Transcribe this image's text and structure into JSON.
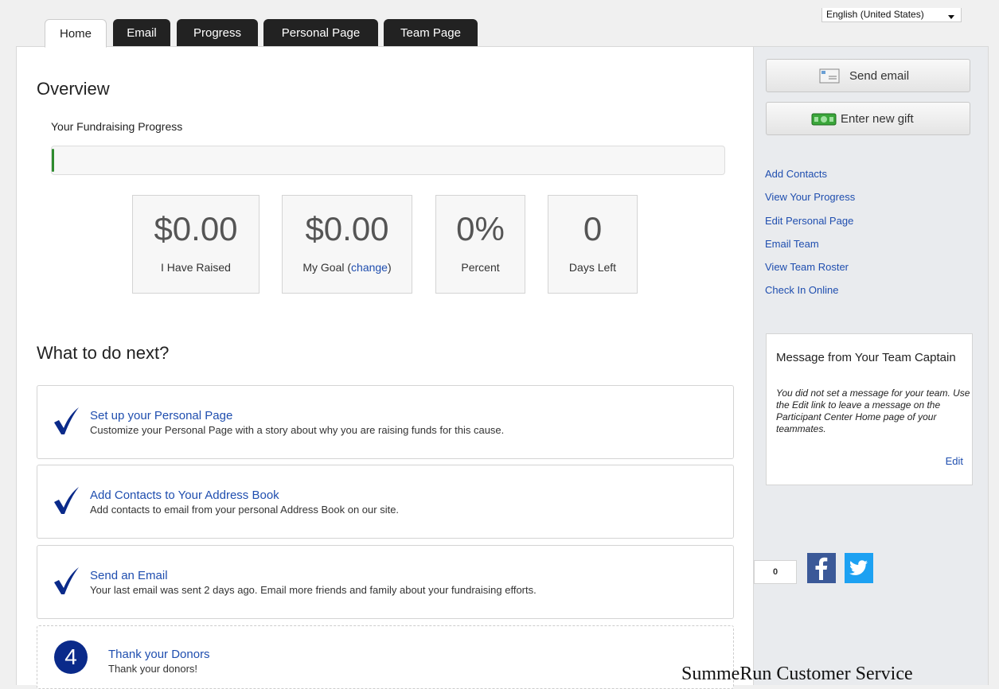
{
  "language": {
    "selected": "English (United States)"
  },
  "tabs": [
    {
      "label": "Home"
    },
    {
      "label": "Email"
    },
    {
      "label": "Progress"
    },
    {
      "label": "Personal Page"
    },
    {
      "label": "Team Page"
    }
  ],
  "overview": {
    "title": "Overview",
    "progress_label": "Your Fundraising Progress",
    "progress_fraction": 0.0,
    "stats": [
      {
        "value": "$0.00",
        "label": "I Have Raised"
      },
      {
        "value": "$0.00",
        "label_prefix": "My Goal (",
        "link": "change",
        "label_suffix": ")"
      },
      {
        "value": "0%",
        "label": "Percent"
      },
      {
        "value": "0",
        "label": "Days Left"
      }
    ]
  },
  "next": {
    "title": "What to do next?",
    "tasks": [
      {
        "title": "Set up your Personal Page",
        "desc": "Customize your Personal Page with a story about why you are raising funds for this cause.",
        "done": true
      },
      {
        "title": "Add Contacts to Your Address Book",
        "desc": "Add contacts to email from your personal Address Book on our site.",
        "done": true
      },
      {
        "title": "Send an Email",
        "desc": "Your last email was sent 2 days ago. Email more friends and family about your fundraising efforts.",
        "done": true
      },
      {
        "title": "Thank your Donors",
        "desc": "Thank your donors!",
        "number": "4",
        "done": false
      }
    ]
  },
  "sidebar": {
    "send_email": "Send email",
    "enter_gift": "Enter new gift",
    "links": [
      "Add Contacts",
      "View Your Progress",
      "Edit Personal Page",
      "Email Team",
      "View Team Roster",
      "Check In Online"
    ],
    "message": {
      "title": "Message from Your Team Captain",
      "body": "You did not set a message for your team. Use the Edit link to leave a message on the Participant Center Home page of your teammates.",
      "edit": "Edit"
    },
    "share_count": "0"
  },
  "footer": {
    "text": "SummeRun Customer Service"
  },
  "colors": {
    "link": "#1f4eaf",
    "tab_dark": "#222222",
    "check": "#0a2a8a",
    "facebook": "#3b5998",
    "twitter": "#1da1f2"
  }
}
